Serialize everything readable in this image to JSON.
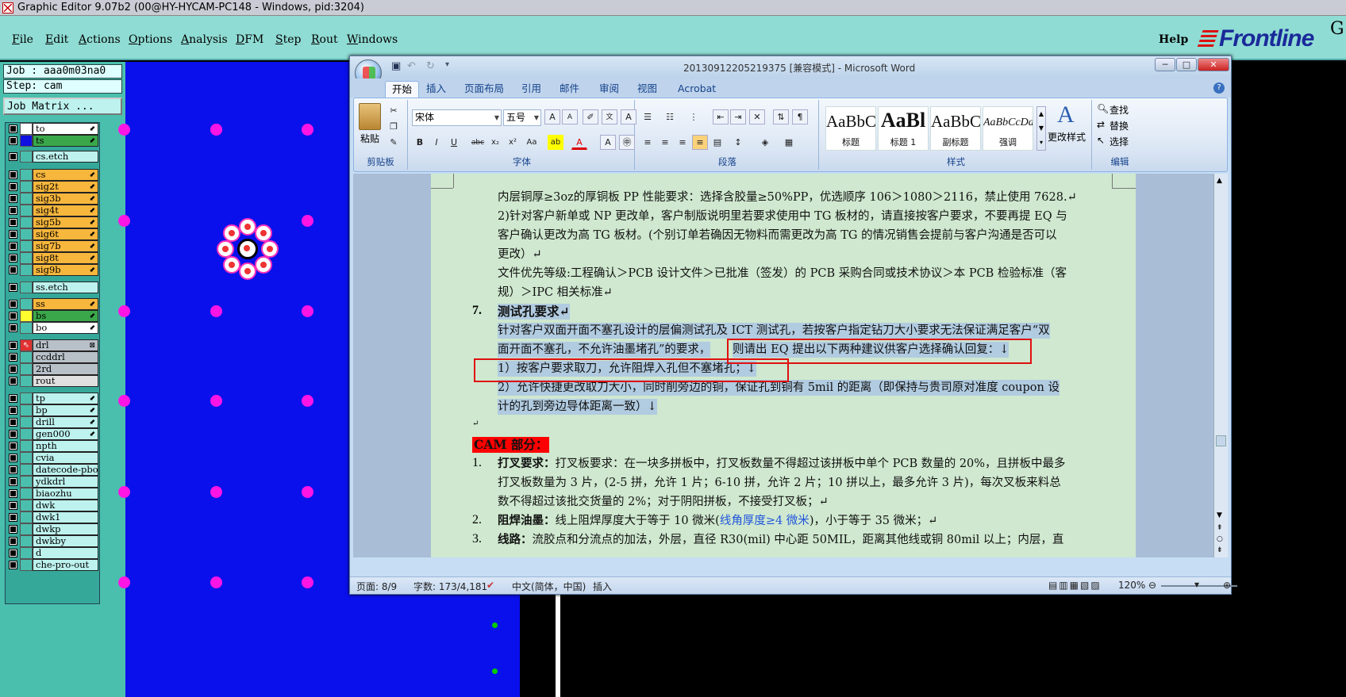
{
  "app": {
    "title": "Graphic Editor 9.07b2 (00@HY-HYCAM-PC148 - Windows, pid:3204)",
    "menu": [
      "File",
      "Edit",
      "Actions",
      "Options",
      "Analysis",
      "DFM",
      "Step",
      "Rout",
      "Windows"
    ],
    "help": "Help",
    "logo": "Frontline",
    "logo_suffix": "G"
  },
  "left_panel": {
    "job": "Job : aaa0m03na0",
    "step": "Step: cam",
    "job_matrix": "Job Matrix ..."
  },
  "layers": [
    {
      "name": "to",
      "color": "#ffffff",
      "bg": "#ffffff",
      "arrow": "⬋"
    },
    {
      "name": "ts",
      "color": "#1010e0",
      "bg": "#3aa84a",
      "arrow": "⬋"
    },
    {
      "name": "cs.etch",
      "color": "",
      "bg": "#bdf2ee",
      "arrow": ""
    },
    {
      "name": "cs",
      "color": "",
      "bg": "#f7b63c",
      "arrow": "⬋"
    },
    {
      "name": "sig2t",
      "color": "",
      "bg": "#f7b63c",
      "arrow": "⬋"
    },
    {
      "name": "sig3b",
      "color": "",
      "bg": "#f7b63c",
      "arrow": "⬋"
    },
    {
      "name": "sig4t",
      "color": "",
      "bg": "#f7b63c",
      "arrow": "⬋"
    },
    {
      "name": "sig5b",
      "color": "",
      "bg": "#f7b63c",
      "arrow": "⬋"
    },
    {
      "name": "sig6t",
      "color": "",
      "bg": "#f7b63c",
      "arrow": "⬋"
    },
    {
      "name": "sig7b",
      "color": "",
      "bg": "#f7b63c",
      "arrow": "⬋"
    },
    {
      "name": "sig8t",
      "color": "",
      "bg": "#f7b63c",
      "arrow": "⬋"
    },
    {
      "name": "sig9b",
      "color": "",
      "bg": "#f7b63c",
      "arrow": "⬋"
    },
    {
      "name": "ss.etch",
      "color": "",
      "bg": "#bdf2ee",
      "arrow": ""
    },
    {
      "name": "ss",
      "color": "",
      "bg": "#f7b63c",
      "arrow": "⬋"
    },
    {
      "name": "bs",
      "color": "#ffff30",
      "bg": "#3aa84a",
      "arrow": "⬋"
    },
    {
      "name": "bo",
      "color": "",
      "bg": "#ffffff",
      "arrow": "⬋"
    },
    {
      "name": "drl",
      "color": "#e03030",
      "bg": "#b8c0c8",
      "arrow": "⊠"
    },
    {
      "name": "ccddrl",
      "color": "",
      "bg": "#b8c0c8",
      "arrow": ""
    },
    {
      "name": "2rd",
      "color": "",
      "bg": "#b8c0c8",
      "arrow": ""
    },
    {
      "name": "rout",
      "color": "",
      "bg": "#e0e0e0",
      "arrow": ""
    },
    {
      "name": "tp",
      "color": "",
      "bg": "#bdf2ee",
      "arrow": "⬋"
    },
    {
      "name": "bp",
      "color": "",
      "bg": "#bdf2ee",
      "arrow": "⬋"
    },
    {
      "name": "drill",
      "color": "",
      "bg": "#bdf2ee",
      "arrow": "⬋"
    },
    {
      "name": "gen000",
      "color": "",
      "bg": "#bdf2ee",
      "arrow": "⬋"
    },
    {
      "name": "npth",
      "color": "",
      "bg": "#bdf2ee",
      "arrow": ""
    },
    {
      "name": "cvia",
      "color": "",
      "bg": "#bdf2ee",
      "arrow": ""
    },
    {
      "name": "datecode-pbo",
      "color": "",
      "bg": "#bdf2ee",
      "arrow": ""
    },
    {
      "name": "ydkdrl",
      "color": "",
      "bg": "#bdf2ee",
      "arrow": ""
    },
    {
      "name": "biaozhu",
      "color": "",
      "bg": "#bdf2ee",
      "arrow": ""
    },
    {
      "name": "dwk",
      "color": "",
      "bg": "#bdf2ee",
      "arrow": ""
    },
    {
      "name": "dwk1",
      "color": "",
      "bg": "#bdf2ee",
      "arrow": ""
    },
    {
      "name": "dwkp",
      "color": "",
      "bg": "#bdf2ee",
      "arrow": ""
    },
    {
      "name": "dwkby",
      "color": "",
      "bg": "#bdf2ee",
      "arrow": ""
    },
    {
      "name": "d",
      "color": "",
      "bg": "#bdf2ee",
      "arrow": ""
    },
    {
      "name": "che-pro-out",
      "color": "",
      "bg": "#bdf2ee",
      "arrow": ""
    }
  ],
  "word": {
    "title": "20130912205219375 [兼容模式] - Microsoft Word",
    "tabs": [
      "开始",
      "插入",
      "页面布局",
      "引用",
      "邮件",
      "审阅",
      "视图",
      "Acrobat"
    ],
    "clipboard": {
      "paste": "粘贴",
      "group": "剪贴板"
    },
    "font": {
      "name": "宋体",
      "size": "五号",
      "group": "字体"
    },
    "paragraph_group": "段落",
    "styles": {
      "group": "样式",
      "items": [
        {
          "preview": "AaBbC",
          "name": "标题"
        },
        {
          "preview": "AaBl",
          "name": "标题 1"
        },
        {
          "preview": "AaBbC",
          "name": "副标题"
        },
        {
          "preview": "AaBbCcDd",
          "name": "强调"
        }
      ],
      "change": "更改样式"
    },
    "editing": {
      "find": "查找",
      "replace": "替换",
      "select": "选择",
      "group": "编辑"
    },
    "doc": {
      "l1": "内层铜厚≥3oz的厚铜板 PP 性能要求：选择含胶量≥50%PP，优选顺序 106＞1080＞2116，禁止使用 7628.↵",
      "l2": "2)针对客户新单或 NP 更改单，客户制版说明里若要求使用中 TG 板材的，请直接按客户要求，不要再提 EQ 与",
      "l3": "客户确认更改为高 TG 板材。(个别订单若确因无物料而需更改为高 TG 的情况销售会提前与客户沟通是否可以",
      "l4": "更改）↵",
      "l5": "文件优先等级:工程确认＞PCB 设计文件＞已批准（签发）的 PCB 采购合同或技术协议＞本 PCB 检验标准（客",
      "l6": "规）＞IPC 相关标准↵",
      "n7": "7.",
      "h7": "测试孔要求↵",
      "l7": "针对客户双面开面不塞孔设计的层偏测试孔及 ICT 测试孔，若按客户指定钻刀大小要求无法保证满足客户“双",
      "l8a": "面开面不塞孔，不允许油墨堵孔”的要求，",
      "l8b": "则请出 EQ 提出以下两种建议供客户选择确认回复：↓",
      "l9": "1）按客户要求取刀，允许阻焊入孔但不塞堵孔；↓",
      "l10": "2）允许快捷更改取刀大小，同时削旁边的铜，保证孔到铜有 5mil 的距离（即保持与贵司原对准度 coupon 设",
      "l11": "计的孔到旁边导体距离一致）↓",
      "blank": "↵",
      "cam": "CAM 部分：",
      "n1": "1.",
      "c1a_b": "打叉要求：",
      "c1a": "打叉板要求：在一块多拼板中，打叉板数量不得超过该拼板中单个 PCB 数量的 20%，且拼板中最多",
      "c1b": "打叉板数量为 3 片，(2-5 拼，允许 1 片；6-10 拼，允许 2 片；10 拼以上，最多允许 3 片)，每次叉板来料总",
      "c1c": "数不得超过该批交货量的 2%；对于阴阳拼板，不接受打叉板；↵",
      "n2": "2.",
      "c2b": "阻焊油墨：",
      "c2a": "线上阻焊厚度大于等于 10 微米(",
      "c2blue": "线角厚度≥4 微米",
      "c2c": ")，小于等于 35 微米；↵",
      "n3": "3.",
      "c3b": "线路：",
      "c3": "流胶点和分流点的加法，外层，直径 R30(mil) 中心距 50MIL，距离其他线或铜 80mil 以上；内层，直"
    },
    "status": {
      "page": "页面: 8/9",
      "words": "字数: 173/4,181",
      "lang": "中文(简体，中国)",
      "insert": "插入",
      "zoom": "120%"
    }
  },
  "colors": {
    "canvas_bg": "#0a10ec",
    "pad": "#ff14e6",
    "menu_bg": "#8fdcd4",
    "panel_bg": "#4bbfae",
    "highlight": "#b1cbe0",
    "red_box": "#e01010"
  }
}
